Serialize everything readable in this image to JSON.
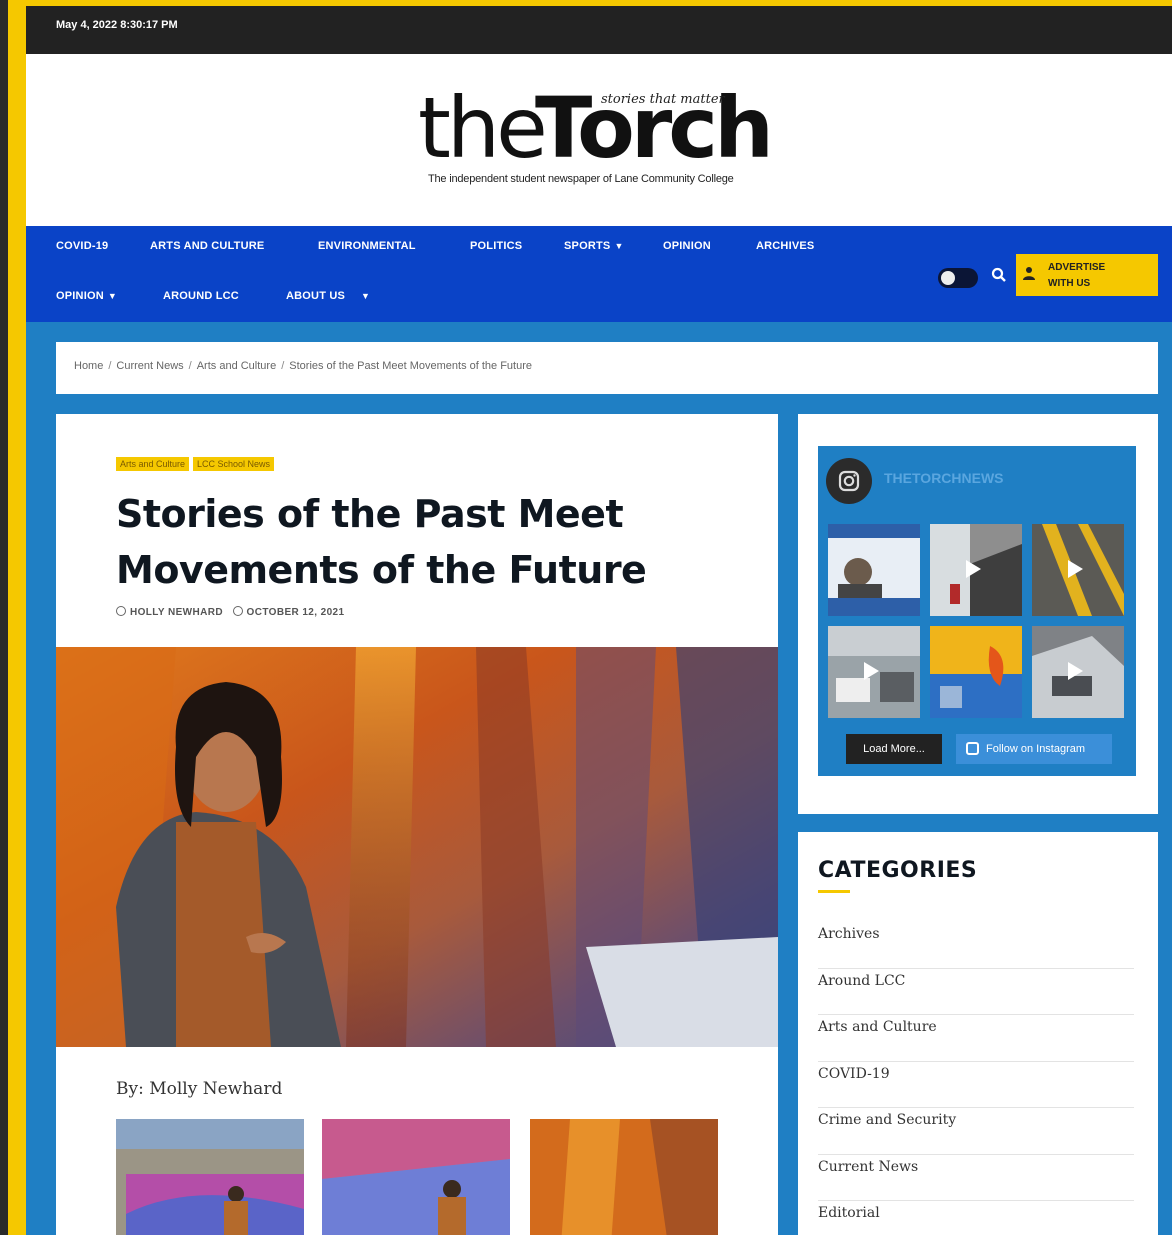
{
  "topbar": {
    "date": "May 4, 2022 8:30:17 PM"
  },
  "logo": {
    "word1": "the",
    "word2": "Torch",
    "tagline": "stories that matter",
    "subtitle": "The independent student newspaper of Lane Community College"
  },
  "nav": {
    "row1": [
      "COVID-19",
      "ARTS AND CULTURE",
      "ENVIRONMENTAL",
      "POLITICS",
      "SPORTS",
      "OPINION",
      "ARCHIVES"
    ],
    "row2": [
      "OPINION",
      "AROUND LCC",
      "ABOUT US"
    ],
    "advertise_line1": "ADVERTISE",
    "advertise_line2": "WITH US"
  },
  "breadcrumb": [
    "Home",
    "Current News",
    "Arts and Culture",
    "Stories of the Past Meet Movements of the Future"
  ],
  "article": {
    "category_tags": [
      "Arts and Culture",
      "LCC School News"
    ],
    "title": "Stories of the Past Meet Movements of the Future",
    "author": "HOLLY NEWHARD",
    "date": "OCTOBER 12, 2021",
    "byline": "By: Molly Newhard"
  },
  "instagram": {
    "handle": "THETORCHNEWS",
    "load_more": "Load More...",
    "follow": "Follow on Instagram"
  },
  "categories": {
    "title": "CATEGORIES",
    "items": [
      "Archives",
      "Around LCC",
      "Arts and Culture",
      "COVID-19",
      "Crime and Security",
      "Current News",
      "Editorial"
    ]
  },
  "colors": {
    "accent_yellow": "#f5c800",
    "nav_blue": "#0a43c7",
    "page_blue": "#1f7fc4",
    "topbar_dark": "#222222"
  }
}
